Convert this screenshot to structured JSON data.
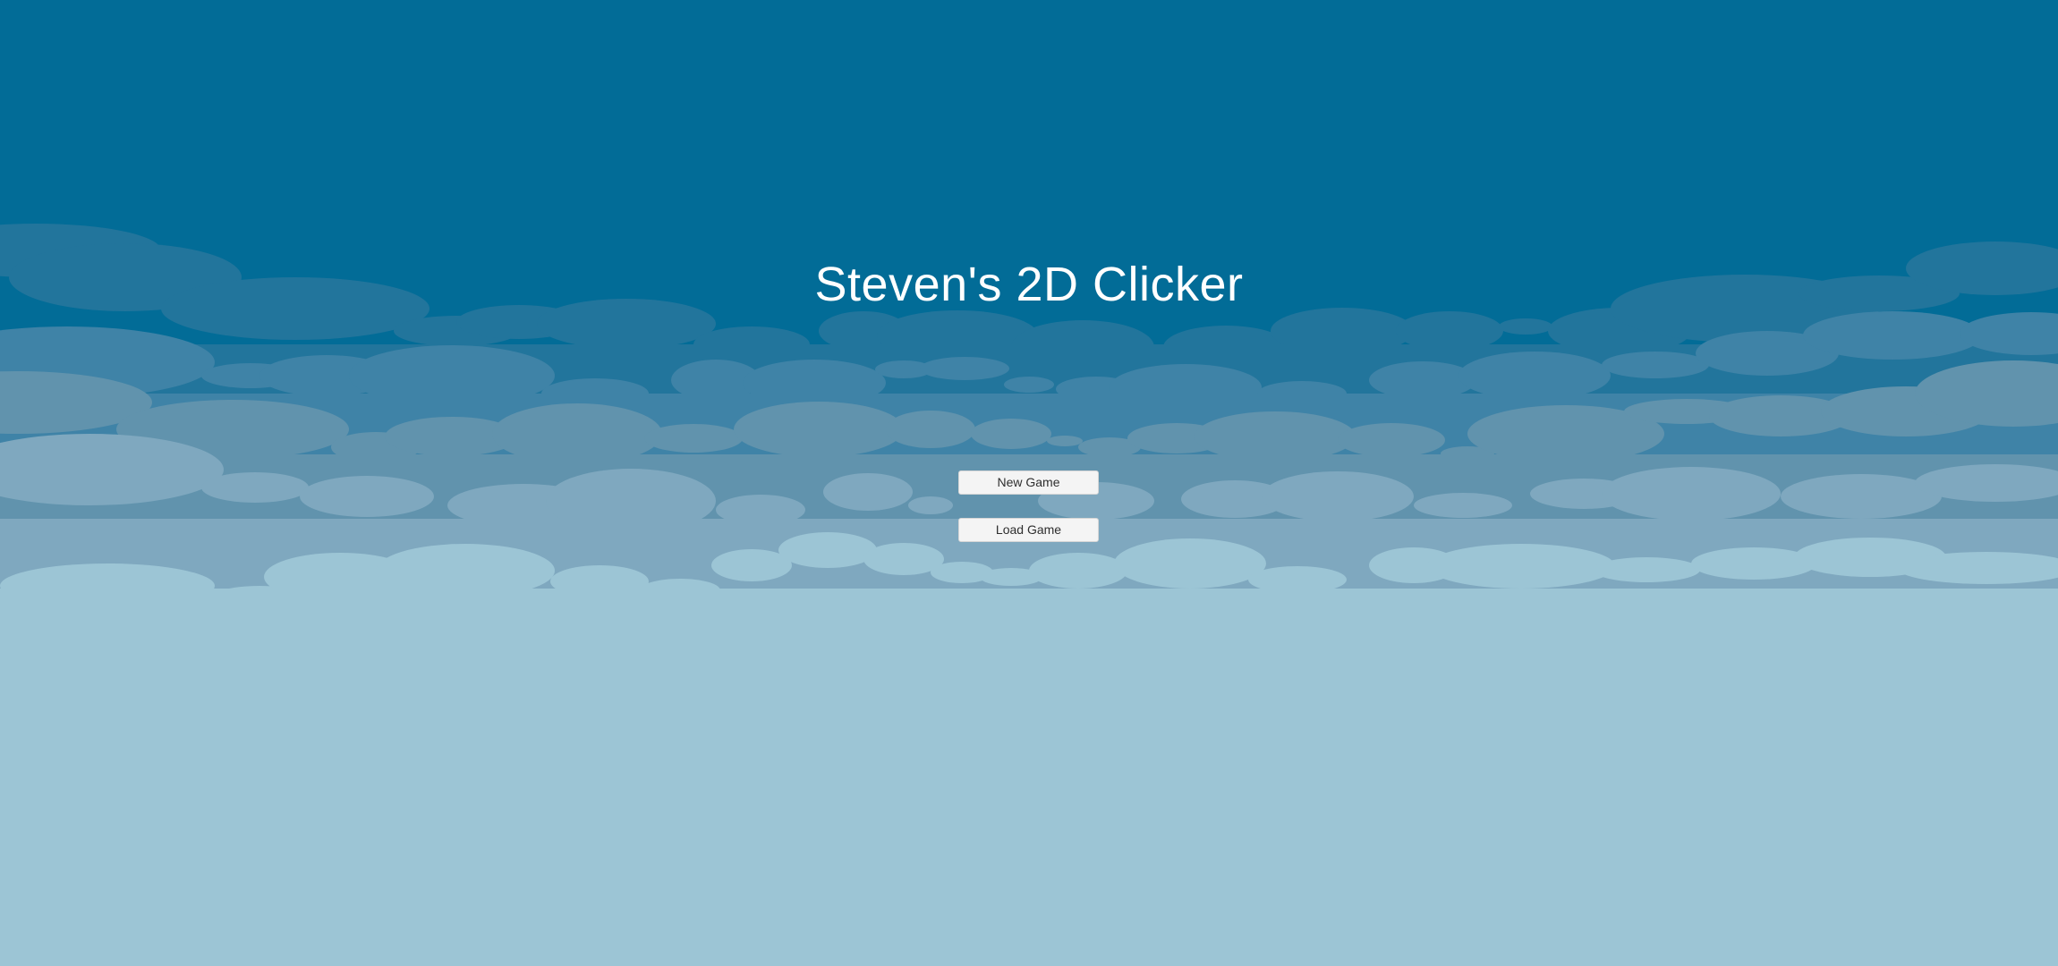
{
  "game": {
    "title": "Steven's 2D Clicker"
  },
  "menu": {
    "new_game_label": "New Game",
    "load_game_label": "Load Game"
  },
  "colors": {
    "sky": "#026c97",
    "cloud_layer_1": "#22759c",
    "cloud_layer_2": "#3f83a7",
    "cloud_layer_3": "#6193ad",
    "cloud_layer_4": "#7fa8bf",
    "cloud_layer_5": "#9cc5d5",
    "button_bg": "#f4f4f4",
    "title_text": "#ffffff"
  }
}
